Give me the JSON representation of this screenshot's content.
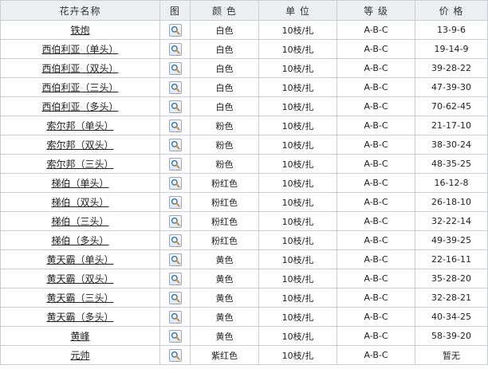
{
  "table": {
    "headers": {
      "name": "花卉名称",
      "image": "图",
      "color": "颜 色",
      "unit": "单 位",
      "grade": "等 级",
      "price": "价 格"
    },
    "rows": [
      {
        "name": "铁炮",
        "color": "白色",
        "unit": "10枝/扎",
        "grade": "A-B-C",
        "price": "13-9-6"
      },
      {
        "name": "西伯利亚（单头）",
        "color": "白色",
        "unit": "10枝/扎",
        "grade": "A-B-C",
        "price": "19-14-9"
      },
      {
        "name": "西伯利亚（双头）",
        "color": "白色",
        "unit": "10枝/扎",
        "grade": "A-B-C",
        "price": "39-28-22"
      },
      {
        "name": "西伯利亚（三头）",
        "color": "白色",
        "unit": "10枝/扎",
        "grade": "A-B-C",
        "price": "47-39-30"
      },
      {
        "name": "西伯利亚（多头）",
        "color": "白色",
        "unit": "10枝/扎",
        "grade": "A-B-C",
        "price": "70-62-45"
      },
      {
        "name": "索尔邦（单头）",
        "color": "粉色",
        "unit": "10枝/扎",
        "grade": "A-B-C",
        "price": "21-17-10"
      },
      {
        "name": "索尔邦（双头）",
        "color": "粉色",
        "unit": "10枝/扎",
        "grade": "A-B-C",
        "price": "38-30-24"
      },
      {
        "name": "索尔邦（三头）",
        "color": "粉色",
        "unit": "10枝/扎",
        "grade": "A-B-C",
        "price": "48-35-25"
      },
      {
        "name": "梯伯（单头）",
        "color": "粉红色",
        "unit": "10枝/扎",
        "grade": "A-B-C",
        "price": "16-12-8"
      },
      {
        "name": "梯伯（双头）",
        "color": "粉红色",
        "unit": "10枝/扎",
        "grade": "A-B-C",
        "price": "26-18-10"
      },
      {
        "name": "梯伯（三头）",
        "color": "粉红色",
        "unit": "10枝/扎",
        "grade": "A-B-C",
        "price": "32-22-14"
      },
      {
        "name": "梯伯（多头）",
        "color": "粉红色",
        "unit": "10枝/扎",
        "grade": "A-B-C",
        "price": "49-39-25"
      },
      {
        "name": "黄天霸（单头）",
        "color": "黄色",
        "unit": "10枝/扎",
        "grade": "A-B-C",
        "price": "22-16-11"
      },
      {
        "name": "黄天霸（双头）",
        "color": "黄色",
        "unit": "10枝/扎",
        "grade": "A-B-C",
        "price": "35-28-20"
      },
      {
        "name": "黄天霸（三头）",
        "color": "黄色",
        "unit": "10枝/扎",
        "grade": "A-B-C",
        "price": "32-28-21"
      },
      {
        "name": "黄天霸（多头）",
        "color": "黄色",
        "unit": "10枝/扎",
        "grade": "A-B-C",
        "price": "40-34-25"
      },
      {
        "name": "黄峰",
        "color": "黄色",
        "unit": "10枝/扎",
        "grade": "A-B-C",
        "price": "58-39-20"
      },
      {
        "name": "元帅",
        "color": "紫红色",
        "unit": "10枝/扎",
        "grade": "A-B-C",
        "price": "暂无"
      }
    ],
    "image_icon": "magnifier-icon"
  },
  "colors": {
    "header_bg": "#eceef1",
    "border": "#c9cdd3",
    "icon_accent": "#2f6fb3"
  }
}
